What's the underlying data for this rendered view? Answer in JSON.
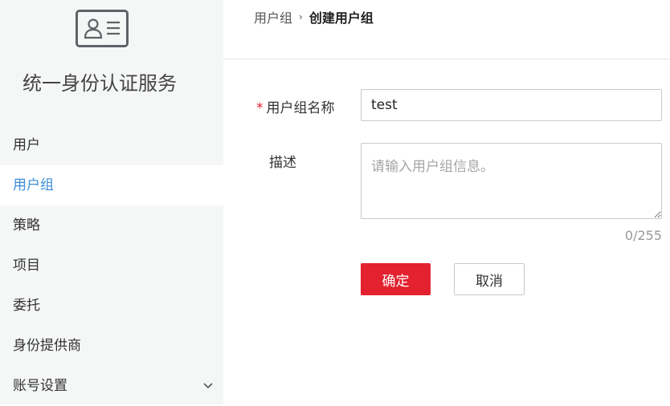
{
  "sidebar": {
    "logo_icon": "id-card-icon",
    "title": "统一身份认证服务",
    "items": [
      {
        "label": "用户",
        "active": false
      },
      {
        "label": "用户组",
        "active": true
      },
      {
        "label": "策略",
        "active": false
      },
      {
        "label": "项目",
        "active": false
      },
      {
        "label": "委托",
        "active": false
      },
      {
        "label": "身份提供商",
        "active": false
      },
      {
        "label": "账号设置",
        "active": false,
        "icon": "chevron-down-icon"
      }
    ]
  },
  "breadcrumb": {
    "parent": "用户组",
    "separator": "›",
    "current": "创建用户组"
  },
  "form": {
    "name_required_mark": "*",
    "name_label": "用户组名称",
    "name_value": "test",
    "description_label": "描述",
    "description_placeholder": "请输入用户组信息。",
    "description_counter": "0/255"
  },
  "actions": {
    "confirm_label": "确定",
    "cancel_label": "取消"
  },
  "colors": {
    "accent": "#3c8dd6",
    "primary_button": "#e3212f",
    "required": "#e0212f",
    "sidebar_bg": "#f5f6f6"
  }
}
